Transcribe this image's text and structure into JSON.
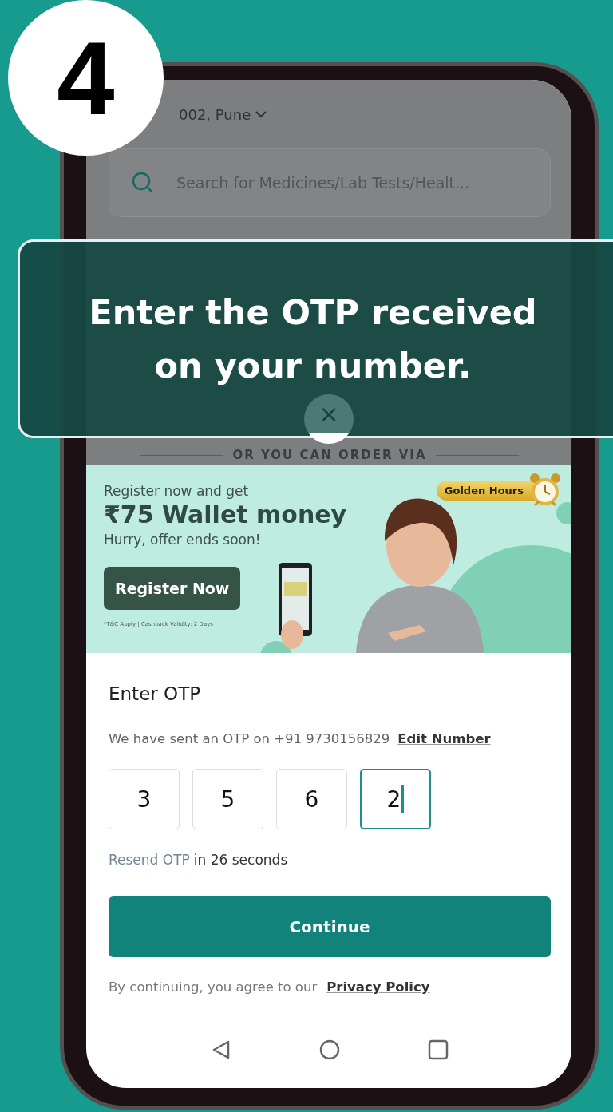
{
  "step_badge": "4",
  "caption": "Enter the OTP received on your number.",
  "location": "002, Pune",
  "search": {
    "placeholder": "Search for Medicines/Lab Tests/Healt..."
  },
  "divider_label": "OR YOU CAN ORDER VIA",
  "close_button": "×",
  "banner": {
    "intro": "Register now and get",
    "headline": "₹75 Wallet money",
    "subline": "Hurry, offer ends soon!",
    "button": "Register Now",
    "terms": "*T&C Apply | Cashback Validity: 2 Days",
    "tag": "Golden Hours"
  },
  "otp": {
    "title": "Enter OTP",
    "message": "We have sent an OTP on +91 9730156829",
    "edit_link": "Edit Number",
    "digits": [
      {
        "value": "3",
        "selected": false
      },
      {
        "value": "5",
        "selected": false
      },
      {
        "value": "6",
        "selected": false
      },
      {
        "value": "2",
        "selected": true
      }
    ],
    "resend_link": "Resend OTP",
    "resend_timer": "in 26 seconds",
    "continue": "Continue",
    "consent": "By continuing, you agree to our",
    "privacy_link": "Privacy Policy"
  }
}
